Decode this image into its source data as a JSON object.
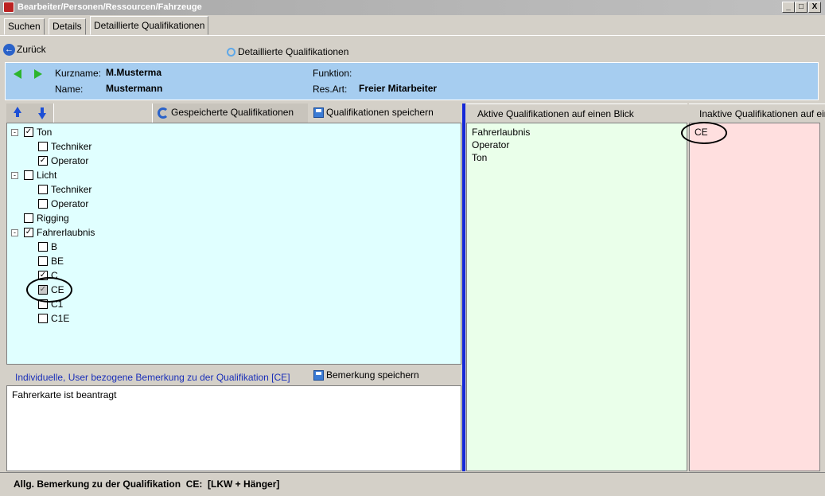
{
  "window": {
    "title": "Bearbeiter/Personen/Ressourcen/Fahrzeuge",
    "min_label": "_",
    "max_label": "□",
    "close_label": "X"
  },
  "tabs": [
    {
      "label": "Suchen"
    },
    {
      "label": "Details"
    },
    {
      "label": "Detaillierte Qualifikationen"
    }
  ],
  "toolbar": {
    "back_label": "Zurück",
    "detail_label": "Detaillierte Qualifikationen"
  },
  "info": {
    "kurzname_label": "Kurzname:",
    "kurzname_value": "M.Musterma",
    "name_label": "Name:",
    "name_value": "Mustermann",
    "funktion_label": "Funktion:",
    "funktion_value": "",
    "resart_label": "Res.Art:",
    "resart_value": "Freier Mitarbeiter"
  },
  "left_toolbar": {
    "saved_label": "Gespeicherte Qualifikationen",
    "save_label": "Qualifikationen speichern"
  },
  "tree": [
    {
      "label": "Ton",
      "checked": true
    },
    {
      "label": "Techniker",
      "checked": false
    },
    {
      "label": "Operator",
      "checked": true
    },
    {
      "label": "Licht",
      "checked": false
    },
    {
      "label": "Techniker",
      "checked": false
    },
    {
      "label": "Operator",
      "checked": false
    },
    {
      "label": "Rigging",
      "checked": false
    },
    {
      "label": "Fahrerlaubnis",
      "checked": true
    },
    {
      "label": "B",
      "checked": false
    },
    {
      "label": "BE",
      "checked": false
    },
    {
      "label": "C",
      "checked": true
    },
    {
      "label": "CE",
      "checked": true,
      "state": "greyed"
    },
    {
      "label": "C1",
      "checked": false
    },
    {
      "label": "C1E",
      "checked": false
    }
  ],
  "remark": {
    "header_label": "Individuelle, User bezogene Bemerkung zu der Qualifikation [CE]",
    "save_label": "Bemerkung speichern",
    "text": "Fahrerkarte ist beantragt"
  },
  "active": {
    "header": "Aktive Qualifikationen auf einen Blick",
    "items": [
      "Fahrerlaubnis",
      "Operator",
      "Ton"
    ]
  },
  "inactive": {
    "header": "Inaktive Qualifikationen auf einen Blick",
    "items": [
      "CE"
    ]
  },
  "status": {
    "text": "Allg. Bemerkung zu der Qualifikation  CE:  [LKW + Hänger]"
  },
  "colors": {
    "info_bg": "#a6cdf0",
    "tree_bg": "#e0ffff",
    "active_bg": "#eaffea",
    "inactive_bg": "#ffdfdf",
    "divider": "#1528d8"
  }
}
